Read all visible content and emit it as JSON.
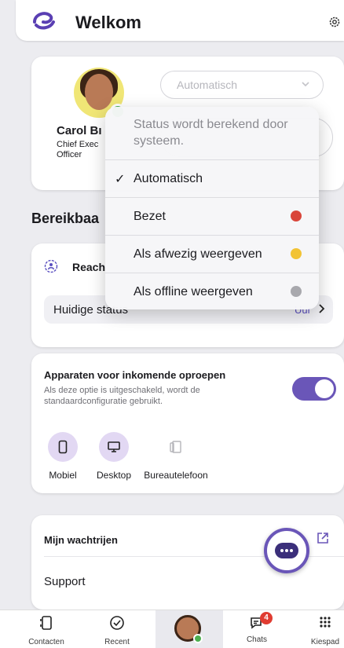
{
  "header": {
    "title": "Welkom"
  },
  "profile": {
    "name": "Carol Bı",
    "role_line1": "Chief Exec",
    "role_line2": "Officer",
    "status_select": "Automatisch"
  },
  "reachability": {
    "section_title": "Bereikbaa",
    "card_label": "Reach",
    "status_row_label": "Huidige status",
    "status_row_value": "Uur"
  },
  "devices": {
    "title": "Apparaten voor inkomende oproepen",
    "description": "Als deze optie is uitgeschakeld, wordt de standaardconfiguratie gebruikt.",
    "toggle_on": true,
    "items": [
      {
        "label": "Mobiel",
        "active": true
      },
      {
        "label": "Desktop",
        "active": true
      },
      {
        "label": "Bureautelefoon",
        "active": false
      }
    ]
  },
  "queues": {
    "title": "Mijn wachtrijen",
    "items": [
      "Support"
    ]
  },
  "status_menu": {
    "info": "Status wordt berekend door systeem.",
    "options": [
      {
        "label": "Automatisch",
        "checked": true,
        "color": ""
      },
      {
        "label": "Bezet",
        "checked": false,
        "color": "#d9453a"
      },
      {
        "label": "Als afwezig weergeven",
        "checked": false,
        "color": "#f2c335"
      },
      {
        "label": "Als offline weergeven",
        "checked": false,
        "color": "#a8a8ad"
      }
    ],
    "check_glyph": "✓"
  },
  "tabbar": {
    "items": [
      {
        "label": "Contacten",
        "icon": "contacts-icon"
      },
      {
        "label": "Recent",
        "icon": "recent-icon"
      },
      {
        "label": "",
        "icon": "profile-avatar"
      },
      {
        "label": "Chats",
        "icon": "chats-icon",
        "badge": "4"
      },
      {
        "label": "Kiespad",
        "icon": "keypad-icon"
      }
    ]
  },
  "colors": {
    "accent": "#6a56b8",
    "presence_available": "#4caf50",
    "badge": "#e03c31"
  }
}
